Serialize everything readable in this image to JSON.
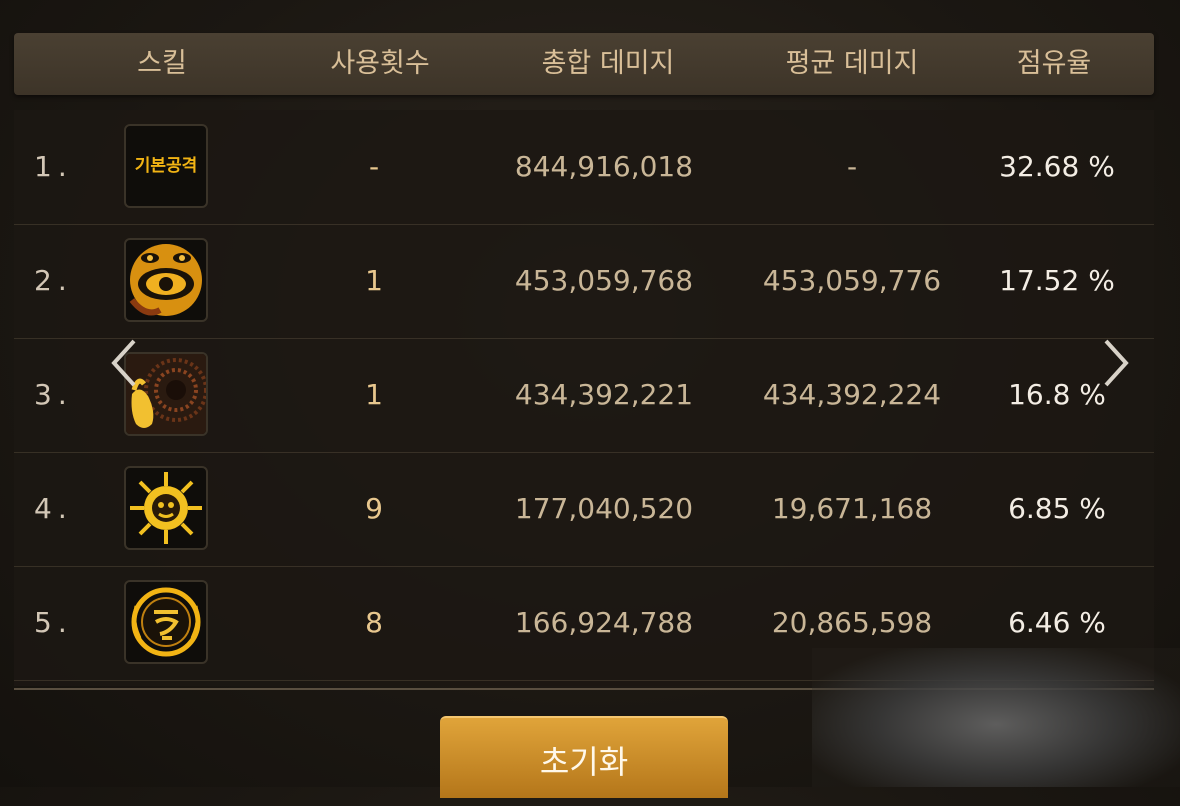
{
  "header": {
    "skill": "스킬",
    "uses": "사용횟수",
    "total_damage": "총합 데미지",
    "avg_damage": "평균 데미지",
    "share": "점유율"
  },
  "rows": [
    {
      "rank": "1.",
      "icon": "basic-attack-icon",
      "icon_text": "기본공격",
      "uses": "-",
      "total": "844,916,018",
      "avg": "-",
      "share": "32.68 %"
    },
    {
      "rank": "2.",
      "icon": "eye-mask-icon",
      "uses": "1",
      "total": "453,059,768",
      "avg": "453,059,776",
      "share": "17.52 %"
    },
    {
      "rank": "3.",
      "icon": "vortex-hand-icon",
      "uses": "1",
      "total": "434,392,221",
      "avg": "434,392,224",
      "share": "16.8 %"
    },
    {
      "rank": "4.",
      "icon": "sun-face-icon",
      "uses": "9",
      "total": "177,040,520",
      "avg": "19,671,168",
      "share": "6.85 %"
    },
    {
      "rank": "5.",
      "icon": "rune-circle-icon",
      "uses": "8",
      "total": "166,924,788",
      "avg": "20,865,598",
      "share": "6.46 %"
    }
  ],
  "reset_button": "초기화",
  "colors": {
    "accent": "#e0a43a",
    "header_bg": "#3d3428",
    "icon_gold": "#f2b414"
  }
}
